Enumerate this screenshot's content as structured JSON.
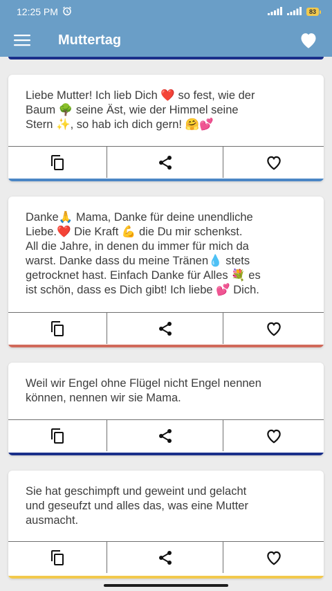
{
  "status_bar": {
    "time": "12:25 PM",
    "battery": "83"
  },
  "app_bar": {
    "title": "Muttertag",
    "menu_icon": "hamburger-menu-icon",
    "favorites_icon": "heart-filled-icon"
  },
  "colors": {
    "primary": "#6a9ec7",
    "accent_blue": "#4a86c5",
    "accent_red": "#d0695a",
    "accent_navy": "#1a2f8a",
    "accent_yellow": "#f2c94c"
  },
  "cards": [
    {
      "text": "Liebe Mutter! Ich lieb Dich ❤️ so fest, wie der\nBaum 🌳 seine Äst,  wie der Himmel seine\nStern ✨, so hab ich dich gern! 🤗💕",
      "accent": "#4a86c5"
    },
    {
      "text": "Danke🙏 Mama, Danke für deine unendliche\nLiebe.❤️ Die Kraft 💪 die Du mir schenkst.\nAll die Jahre, in denen du immer für mich da\nwarst. Danke dass du meine Tränen💧 stets\ngetrocknet hast. Einfach Danke für Alles 💐 es\nist schön, dass es Dich gibt! Ich liebe 💕 Dich.",
      "accent": "#d0695a"
    },
    {
      "text": "Weil wir Engel ohne Flügel nicht Engel nennen\nkönnen, nennen wir sie Mama.",
      "accent": "#1a2f8a"
    },
    {
      "text": "Sie hat geschimpft und geweint und gelacht\nund geseufzt und alles das, was eine Mutter\nausmacht.",
      "accent": "#f2c94c"
    }
  ],
  "card_actions": {
    "copy_icon": "copy-icon",
    "share_icon": "share-icon",
    "like_icon": "heart-outline-icon"
  }
}
